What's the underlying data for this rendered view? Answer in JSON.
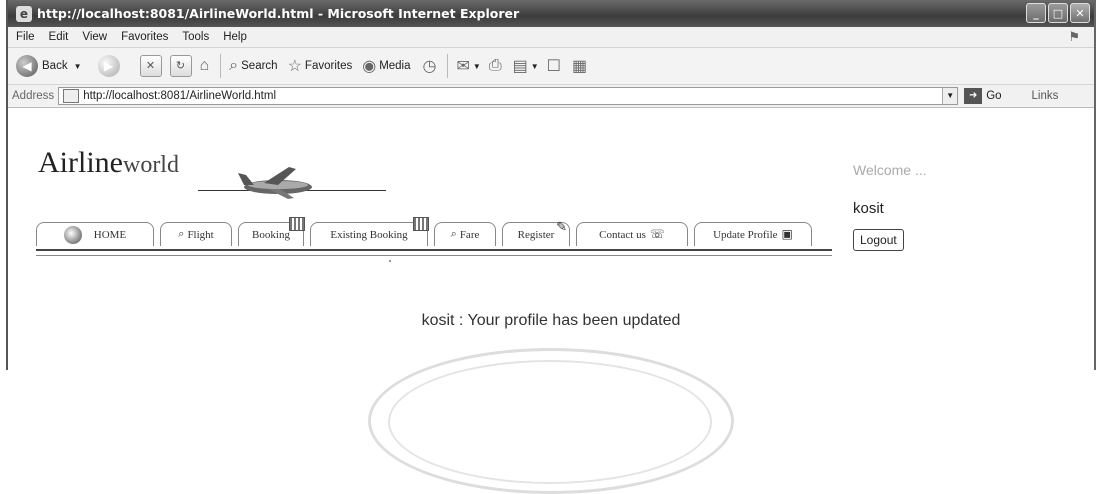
{
  "window": {
    "title": "http://localhost:8081/AirlineWorld.html - Microsoft Internet Explorer",
    "icon": "ie-icon",
    "controls": [
      "minimize",
      "maximize",
      "close"
    ]
  },
  "menubar": {
    "items": [
      "File",
      "Edit",
      "View",
      "Favorites",
      "Tools",
      "Help"
    ]
  },
  "toolbar": {
    "back_label": "Back",
    "search_label": "Search",
    "favorites_label": "Favorites",
    "media_label": "Media"
  },
  "addressbar": {
    "label": "Address",
    "url": "http://localhost:8081/AirlineWorld.html",
    "go_label": "Go",
    "links_label": "Links"
  },
  "page": {
    "logo": {
      "part1": "Airline",
      "part2": "world"
    },
    "nav": [
      {
        "label": "HOME",
        "icon": "globe-icon"
      },
      {
        "label": "Flight",
        "icon": "magnifier-icon"
      },
      {
        "label": "Booking",
        "icon": "calendar-icon"
      },
      {
        "label": "Existing Booking",
        "icon": "calendar-icon"
      },
      {
        "label": "Fare",
        "icon": "magnifier-icon"
      },
      {
        "label": "Register",
        "icon": "pencil-icon"
      },
      {
        "label": "Contact us",
        "icon": "phone-icon"
      },
      {
        "label": "Update Profile",
        "icon": "profile-icon"
      }
    ],
    "welcome": "Welcome ...",
    "username": "kosit",
    "logout_label": "Logout",
    "message": "kosit : Your profile has been updated"
  }
}
